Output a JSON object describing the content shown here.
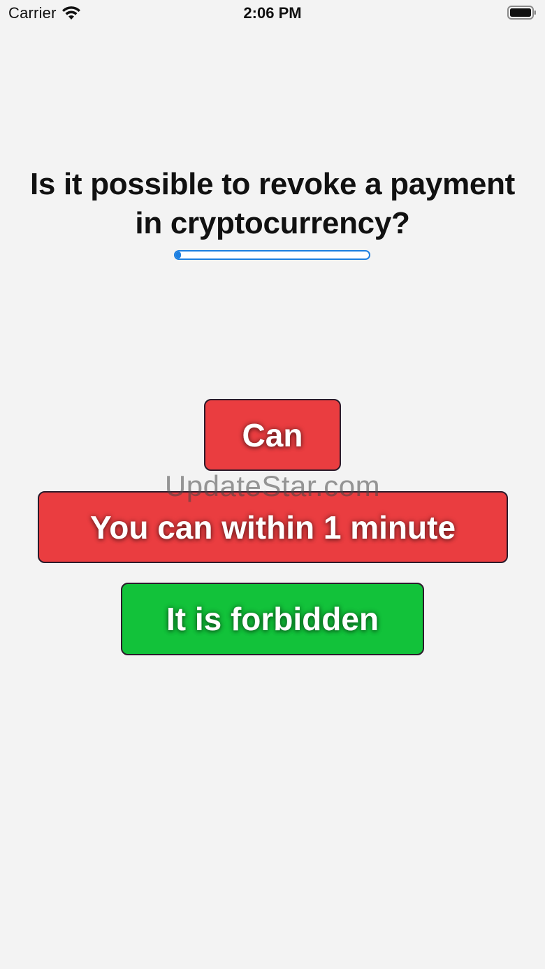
{
  "status_bar": {
    "carrier": "Carrier",
    "time": "2:06 PM",
    "wifi_icon": "wifi-icon",
    "battery_icon": "battery-icon"
  },
  "question": {
    "line1": "Is it possible to revoke a payment",
    "line2": "in cryptocurrency?"
  },
  "progress": {
    "fraction": 0.03,
    "color": "#1d7fe0"
  },
  "answers": [
    {
      "label": "Can",
      "color": "#ea3d40"
    },
    {
      "label": "You can within 1 minute",
      "color": "#ea3d40"
    },
    {
      "label": "It is forbidden",
      "color": "#12c23a"
    }
  ],
  "watermark": "UpdateStar.com"
}
